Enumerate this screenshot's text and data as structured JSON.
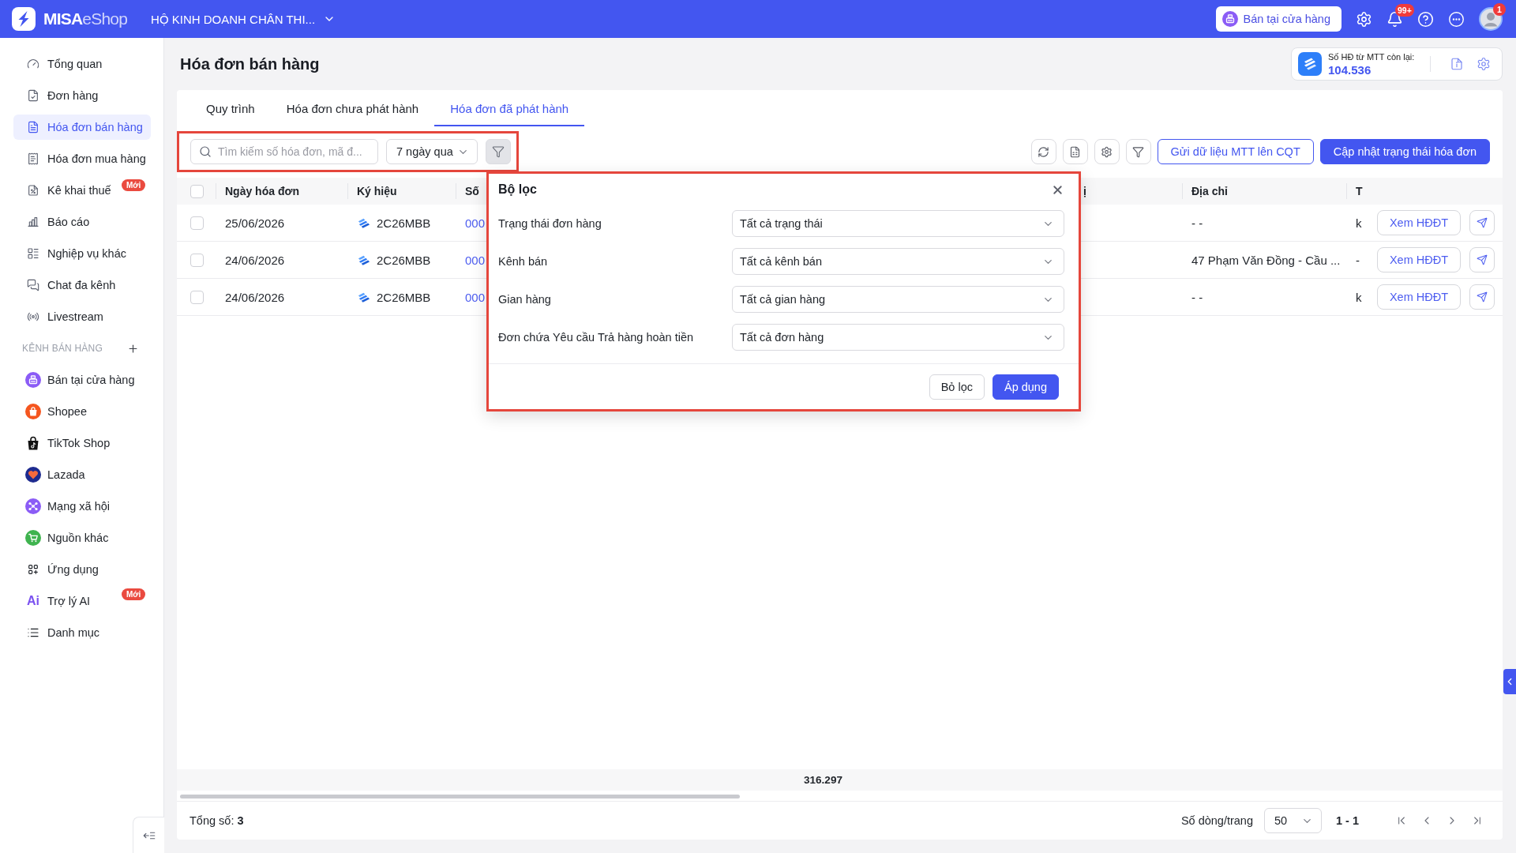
{
  "top_bar": {
    "logo_text": "**MISA**eShop",
    "store_name": "HỘ KINH DOANH CHÂN THI...",
    "store_mode_button": "Bán tại cửa hàng",
    "notifications_badge": "99+",
    "account_badge": "1"
  },
  "sidebar": {
    "items": [
      {
        "label": "Tổng quan",
        "selected": false
      },
      {
        "label": "Đơn hàng",
        "selected": false
      },
      {
        "label": "Hóa đơn bán hàng",
        "selected": true
      },
      {
        "label": "Hóa đơn mua hàng",
        "selected": false
      },
      {
        "label": "Kê khai thuế",
        "selected": false,
        "badge": "Mới"
      },
      {
        "label": "Báo cáo",
        "selected": false
      },
      {
        "label": "Nghiệp vụ khác",
        "selected": false
      },
      {
        "label": "Chat đa kênh",
        "selected": false
      },
      {
        "label": "Livestream",
        "selected": false
      }
    ],
    "section_title": "KÊNH BÁN HÀNG",
    "channels": [
      {
        "label": "Bán tại cửa hàng",
        "selected": false
      },
      {
        "label": "Shopee",
        "selected": false
      },
      {
        "label": "TikTok Shop",
        "selected": false
      },
      {
        "label": "Lazada",
        "selected": false
      },
      {
        "label": "Mạng xã hội",
        "selected": false
      },
      {
        "label": "Nguồn khác",
        "selected": false
      },
      {
        "label": "Ứng dụng",
        "selected": false
      },
      {
        "label": "Trợ lý AI",
        "selected": false,
        "badge": "Mới",
        "icon_text": "Ai"
      },
      {
        "label": "Danh mục",
        "selected": false
      }
    ]
  },
  "page": {
    "title": "Hóa đơn bán hàng",
    "quota": {
      "label": "Số HĐ từ MTT còn lại:",
      "value": "104.536"
    },
    "tabs": [
      {
        "label": "Quy trình",
        "selected": false
      },
      {
        "label": "Hóa đơn chưa phát hành",
        "selected": false
      },
      {
        "label": "Hóa đơn đã phát hành",
        "selected": true
      }
    ],
    "toolbar": {
      "highlighted": true,
      "search": {
        "placeholder": "Tìm kiếm số hóa đơn, mã đ..."
      },
      "date_range": "7 ngày qua",
      "filter_on": true,
      "buttons": [
        {
          "label": "Gửi dữ liệu MTT lên CQT",
          "kind": "outline"
        },
        {
          "label": "Cập nhật trạng thái hóa đơn",
          "kind": "primary"
        }
      ]
    },
    "table": {
      "all_checked": false,
      "columns": [
        {
          "label": "Ngày hóa đơn"
        },
        {
          "label": "Ký hiệu"
        },
        {
          "label": "Số"
        },
        {
          "label": "ị"
        },
        {
          "label": "Địa chỉ"
        },
        {
          "label": "T"
        }
      ],
      "rows": [
        {
          "checked": false,
          "date": "25/06/2026",
          "symbol": "2C26MBB",
          "column_3": "000",
          "address": "- -",
          "column_6": "k",
          "action": "Xem HĐĐT"
        },
        {
          "checked": false,
          "date": "24/06/2026",
          "symbol": "2C26MBB",
          "column_3": "000",
          "address": "47 Phạm Văn Đồng - Cầu ...",
          "column_6": "-",
          "action": "Xem HĐĐT"
        },
        {
          "checked": false,
          "date": "24/06/2026",
          "symbol": "2C26MBB",
          "column_3": "000",
          "address": "- -",
          "column_6": "k",
          "action": "Xem HĐĐT"
        }
      ],
      "total": "316.297"
    },
    "footer": {
      "total": "Tổng số: **3**",
      "page_size_label": "Số dòng/trang",
      "page_size": "50",
      "range": "1 - 1"
    }
  },
  "filter_panel": {
    "highlighted": true,
    "title": "Bộ lọc",
    "fields": [
      {
        "label": "Trạng thái đơn hàng",
        "value": "Tất cả trạng thái"
      },
      {
        "label": "Kênh bán",
        "value": "Tất cả kênh bán"
      },
      {
        "label": "Gian hàng",
        "value": "Tất cả gian hàng"
      },
      {
        "label": "Đơn chứa Yêu cầu Trả hàng hoàn tiền",
        "value": "Tất cả đơn hàng"
      }
    ],
    "buttons": [
      {
        "label": "Bỏ lọc",
        "kind": "outline"
      },
      {
        "label": "Áp dụng",
        "kind": "primary"
      }
    ]
  }
}
